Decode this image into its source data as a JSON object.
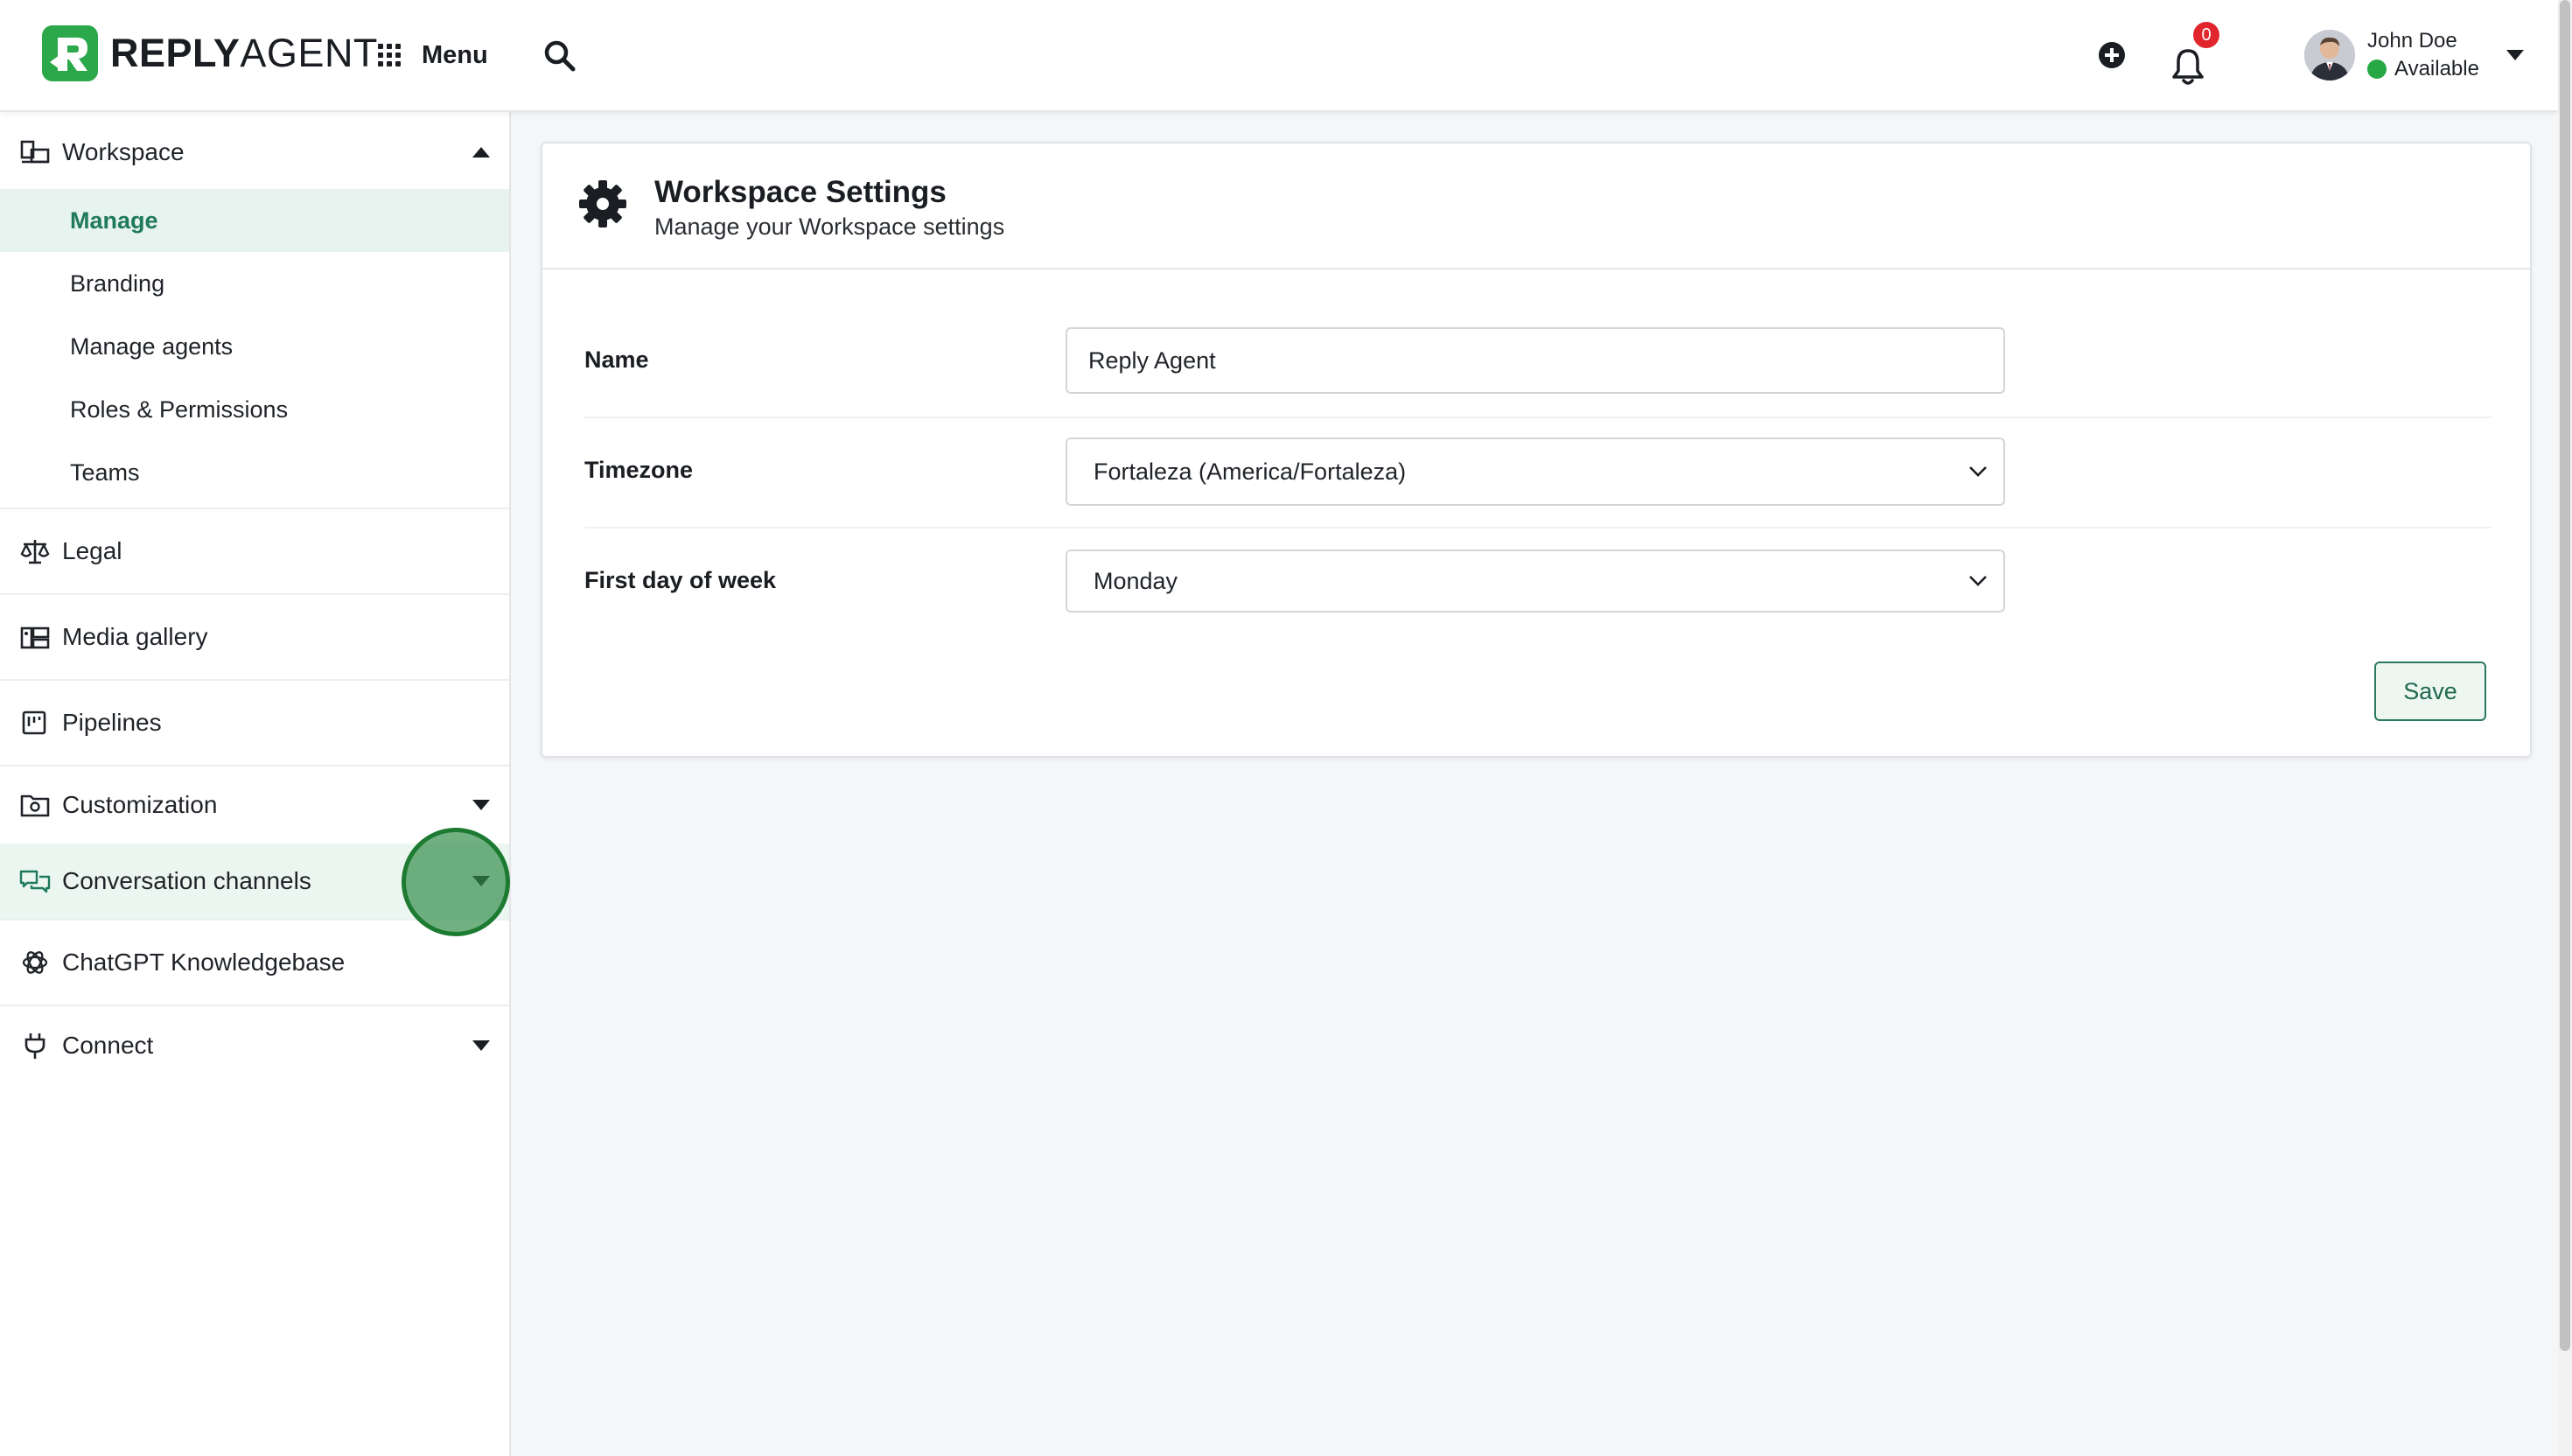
{
  "brand": {
    "name_bold": "REPLY",
    "name_thin": "AGENT",
    "color": "#2aa84a"
  },
  "topbar": {
    "menu_label": "Menu",
    "notification_count": "0",
    "user": {
      "name": "John Doe",
      "status": "Available",
      "status_color": "#27a844"
    },
    "icons": [
      "grid-icon",
      "search-icon",
      "plus-circle-icon",
      "bell-icon",
      "chevron-down-icon"
    ]
  },
  "sidebar": {
    "workspace": {
      "label": "Workspace",
      "items": [
        "Manage",
        "Branding",
        "Manage agents",
        "Roles & Permissions",
        "Teams"
      ],
      "active": "Manage"
    },
    "sections": [
      {
        "label": "Legal",
        "icon": "scale-icon"
      },
      {
        "label": "Media gallery",
        "icon": "gallery-icon"
      },
      {
        "label": "Pipelines",
        "icon": "pipeline-icon"
      },
      {
        "label": "Customization",
        "icon": "folder-gear-icon"
      },
      {
        "label": "Conversation channels",
        "icon": "chat-bubbles-icon"
      },
      {
        "label": "ChatGPT Knowledgebase",
        "icon": "openai-icon"
      },
      {
        "label": "Connect",
        "icon": "plug-icon"
      }
    ],
    "accent": "#1f7a5c"
  },
  "settings": {
    "title": "Workspace Settings",
    "subtitle": "Manage your Workspace settings",
    "fields": {
      "name": {
        "label": "Name",
        "value": "Reply Agent"
      },
      "timezone": {
        "label": "Timezone",
        "value": "Fortaleza (America/Fortaleza)"
      },
      "first_day": {
        "label": "First day of week",
        "value": "Monday"
      }
    },
    "save_label": "Save"
  }
}
